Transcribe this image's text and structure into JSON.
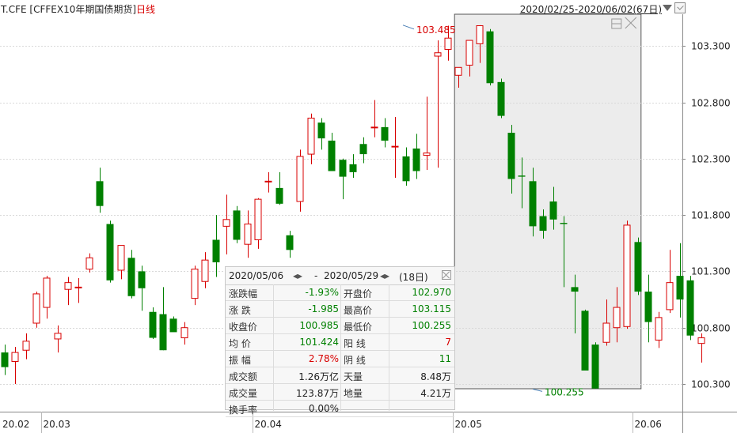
{
  "header": {
    "symbol": "T.CFE [CFFEX10年期国债期货]",
    "period": "日线",
    "date_range": "2020/02/25-2020/06/02(67日)"
  },
  "colors": {
    "up": "#d80000",
    "down": "#008000",
    "grid": "#d9d9d9",
    "selection": "#ececec"
  },
  "chart_data": {
    "type": "candlestick",
    "y_ticks": [
      100.3,
      100.8,
      101.3,
      101.8,
      102.3,
      102.8,
      103.3
    ],
    "y_tick_labels": [
      "100.300",
      "100.800",
      "101.300",
      "101.800",
      "102.300",
      "102.800",
      "103.300"
    ],
    "ylim": [
      100.1,
      103.55
    ],
    "x_labels": [
      "20.02",
      "20.03",
      "20.04",
      "20.05",
      "20.06"
    ],
    "x_label_index": [
      0,
      4,
      24,
      43,
      60
    ],
    "selection": {
      "from_index": 43,
      "to_index": 60
    },
    "annotations": {
      "high_text": "103.485",
      "high_index": 38,
      "low_text": "100.255",
      "low_index": 50
    },
    "ohlc": [
      [
        100.58,
        100.65,
        100.38,
        100.45
      ],
      [
        100.5,
        100.63,
        100.3,
        100.58
      ],
      [
        100.6,
        100.75,
        100.52,
        100.68
      ],
      [
        100.84,
        101.12,
        100.8,
        101.1
      ],
      [
        100.98,
        101.26,
        100.88,
        101.24
      ],
      [
        100.7,
        100.82,
        100.58,
        100.75
      ],
      [
        101.14,
        101.25,
        101.0,
        101.2
      ],
      [
        101.16,
        101.24,
        101.02,
        101.16
      ],
      [
        101.32,
        101.46,
        101.29,
        101.42
      ],
      [
        102.1,
        102.22,
        101.82,
        101.88
      ],
      [
        101.72,
        101.75,
        101.2,
        101.22
      ],
      [
        101.31,
        101.53,
        101.23,
        101.53
      ],
      [
        101.42,
        101.49,
        101.06,
        101.08
      ],
      [
        101.3,
        101.35,
        100.95,
        101.15
      ],
      [
        100.94,
        100.98,
        100.7,
        100.71
      ],
      [
        100.92,
        101.16,
        100.6,
        100.6
      ],
      [
        100.88,
        100.9,
        100.8,
        100.76
      ],
      [
        100.71,
        100.85,
        100.65,
        100.8
      ],
      [
        101.06,
        101.35,
        101.0,
        101.32
      ],
      [
        101.21,
        101.47,
        101.15,
        101.4
      ],
      [
        101.58,
        101.8,
        101.25,
        101.38
      ],
      [
        101.7,
        101.98,
        101.45,
        101.76
      ],
      [
        101.84,
        101.88,
        101.55,
        101.58
      ],
      [
        101.54,
        101.84,
        101.42,
        101.72
      ],
      [
        101.58,
        101.95,
        101.5,
        101.94
      ],
      [
        102.1,
        102.18,
        102.0,
        102.1
      ],
      [
        102.04,
        102.18,
        101.89,
        101.9
      ],
      [
        101.62,
        101.66,
        101.42,
        101.49
      ],
      [
        101.92,
        102.38,
        101.83,
        102.32
      ],
      [
        102.34,
        102.7,
        102.25,
        102.66
      ],
      [
        102.62,
        102.66,
        102.38,
        102.48
      ],
      [
        102.46,
        102.53,
        102.19,
        102.19
      ],
      [
        102.29,
        102.3,
        101.94,
        102.14
      ],
      [
        102.25,
        102.34,
        102.13,
        102.18
      ],
      [
        102.43,
        102.49,
        102.26,
        102.34
      ],
      [
        102.58,
        102.82,
        102.49,
        102.58
      ],
      [
        102.58,
        102.66,
        102.4,
        102.46
      ],
      [
        102.41,
        102.67,
        102.13,
        102.41
      ],
      [
        102.32,
        102.4,
        102.06,
        102.1
      ],
      [
        102.39,
        102.52,
        102.12,
        102.19
      ],
      [
        102.33,
        102.85,
        102.2,
        102.35
      ],
      [
        103.21,
        103.35,
        102.22,
        103.24
      ],
      [
        103.27,
        103.48,
        103.17,
        103.37
      ],
      [
        103.04,
        103.06,
        102.93,
        103.11
      ],
      [
        103.13,
        103.35,
        103.03,
        103.35
      ],
      [
        103.32,
        103.485,
        103.15,
        103.48
      ],
      [
        103.43,
        103.45,
        102.95,
        102.97
      ],
      [
        102.98,
        103.01,
        102.66,
        102.68
      ],
      [
        102.53,
        102.6,
        101.99,
        102.12
      ],
      [
        102.15,
        102.31,
        101.86,
        102.14
      ],
      [
        102.1,
        102.22,
        101.61,
        101.7
      ],
      [
        101.79,
        101.85,
        101.59,
        101.66
      ],
      [
        101.92,
        102.05,
        101.67,
        101.76
      ],
      [
        101.73,
        101.79,
        101.16,
        101.72
      ],
      [
        101.16,
        101.27,
        100.75,
        101.12
      ],
      [
        100.95,
        100.96,
        100.44,
        100.42
      ],
      [
        100.65,
        100.67,
        100.26,
        100.26
      ],
      [
        100.67,
        101.05,
        100.64,
        100.84
      ],
      [
        100.8,
        101.16,
        100.67,
        100.98
      ],
      [
        100.81,
        101.75,
        100.79,
        101.71
      ],
      [
        101.56,
        101.6,
        101.09,
        101.12
      ],
      [
        101.12,
        101.27,
        100.67,
        100.85
      ],
      [
        100.69,
        100.94,
        100.62,
        100.89
      ],
      [
        100.96,
        101.49,
        100.93,
        101.2
      ],
      [
        101.26,
        101.55,
        100.89,
        101.05
      ],
      [
        101.22,
        101.26,
        100.69,
        100.73
      ],
      [
        100.66,
        100.75,
        100.49,
        100.71
      ]
    ]
  },
  "info_panel": {
    "from": "2020/05/06",
    "sep": "-",
    "to": "2020/05/29",
    "days": "(18日)",
    "rows": [
      [
        "涨跌幅",
        "-1.93%",
        "开盘价",
        "102.970"
      ],
      [
        "涨  跌",
        "-1.985",
        "最高价",
        "103.115"
      ],
      [
        "收盘价",
        "100.985",
        "最低价",
        "100.255"
      ],
      [
        "均  价",
        "101.424",
        "阳  线",
        "7"
      ],
      [
        "振  幅",
        "2.78%",
        "阴  线",
        "11"
      ],
      [
        "成交额",
        "1.26万亿",
        "天量",
        "8.48万"
      ],
      [
        "成交量",
        "123.87万",
        "地量",
        "4.21万"
      ],
      [
        "换手率",
        "0.00%",
        "",
        ""
      ]
    ]
  }
}
